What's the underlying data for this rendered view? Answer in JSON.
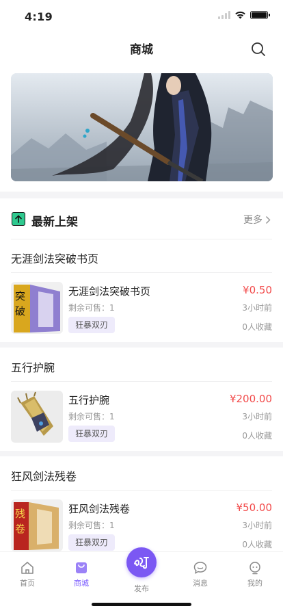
{
  "status_bar": {
    "time": "4:19"
  },
  "header": {
    "title": "商城"
  },
  "new_arrivals": {
    "title": "最新上架",
    "more_label": "更多"
  },
  "listings": [
    {
      "group_title": "无涯剑法突破书页",
      "name": "无涯剑法突破书页",
      "stock_label": "剩余可售：1",
      "tag": "狂暴双刃",
      "price": "¥0.50",
      "time": "3小时前",
      "favorites": "0人收藏"
    },
    {
      "group_title": "五行护腕",
      "name": "五行护腕",
      "stock_label": "剩余可售：1",
      "tag": "狂暴双刃",
      "price": "¥200.00",
      "time": "3小时前",
      "favorites": "0人收藏"
    },
    {
      "group_title": "狂风剑法残卷",
      "name": "狂风剑法残卷",
      "stock_label": "剩余可售：1",
      "tag": "狂暴双刃",
      "price": "¥50.00",
      "time": "3小时前",
      "favorites": "0人收藏"
    }
  ],
  "thumb_glyphs": {
    "book1": "突破",
    "book3": "残卷"
  },
  "tabbar": {
    "items": [
      {
        "label": "首页",
        "icon": "home-icon"
      },
      {
        "label": "商城",
        "icon": "shop-bag-icon"
      },
      {
        "label": "发布",
        "icon": "publish-icon"
      },
      {
        "label": "消息",
        "icon": "message-icon"
      },
      {
        "label": "我的",
        "icon": "profile-icon"
      }
    ]
  },
  "colors": {
    "accent": "#7b58f3",
    "price": "#f24b4b",
    "tag_bg": "#eeebfb",
    "new_icon": "#2fc98f"
  }
}
